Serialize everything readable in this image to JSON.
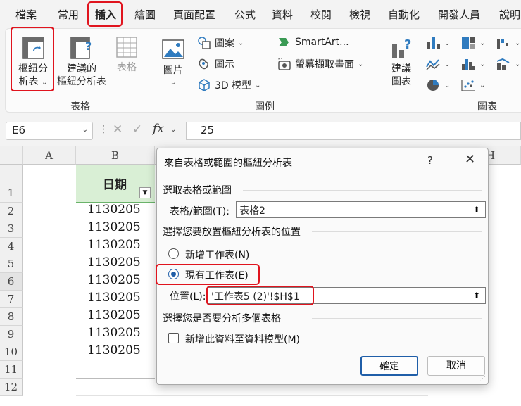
{
  "tabs": [
    "檔案",
    "常用",
    "插入",
    "繪圖",
    "頁面配置",
    "公式",
    "資料",
    "校閱",
    "檢視",
    "自動化",
    "開發人員",
    "說明"
  ],
  "ribbon": {
    "tables_group": {
      "label": "表格",
      "pivot": {
        "line1": "樞紐分",
        "line2": "析表",
        "icon": "pivot-table-icon"
      },
      "recommended": {
        "line1": "建議的",
        "line2": "樞紐分析表",
        "icon": "recommended-pivot-icon"
      },
      "table": {
        "label": "表格",
        "icon": "table-icon"
      }
    },
    "illustrations_group": {
      "label": "圖例",
      "pictures": {
        "label": "圖片"
      },
      "shapes": "圖案",
      "icons": "圖示",
      "models3d": "3D 模型",
      "smartart": "SmartArt...",
      "screenshot": "螢幕擷取畫面"
    },
    "charts_group": {
      "label": "圖表",
      "recommended": {
        "line1": "建議",
        "line2": "圖表"
      }
    }
  },
  "formula_bar": {
    "name_box": "E6",
    "fx": "fx",
    "value": "25"
  },
  "grid": {
    "columns": [
      "A",
      "B",
      "H"
    ],
    "header_cell": "日期",
    "rows": [
      "1",
      "2",
      "3",
      "4",
      "5",
      "6",
      "7",
      "8",
      "9",
      "10",
      "11",
      "12"
    ],
    "values": [
      "1130205",
      "1130205",
      "1130205",
      "1130205",
      "1130205",
      "1130205",
      "1130205",
      "1130205",
      "1130205"
    ]
  },
  "dialog": {
    "title": "來自表格或範圍的樞紐分析表",
    "help": "?",
    "close": "✕",
    "section1": "選取表格或範圍",
    "range_label": "表格/範圍(T):",
    "range_value": "表格2",
    "section2": "選擇您要放置樞紐分析表的位置",
    "new_sheet": "新增工作表(N)",
    "existing_sheet": "現有工作表(E)",
    "location_label": "位置(L):",
    "location_value": "'工作表5 (2)'!$H$1",
    "section3": "選擇您是否要分析多個表格",
    "add_model": "新增此資料至資料模型(M)",
    "ok": "確定",
    "cancel": "取消"
  },
  "colors": {
    "highlight": "#e0141e",
    "accent": "#1f5ea8",
    "table_header": "#d9efd5"
  }
}
